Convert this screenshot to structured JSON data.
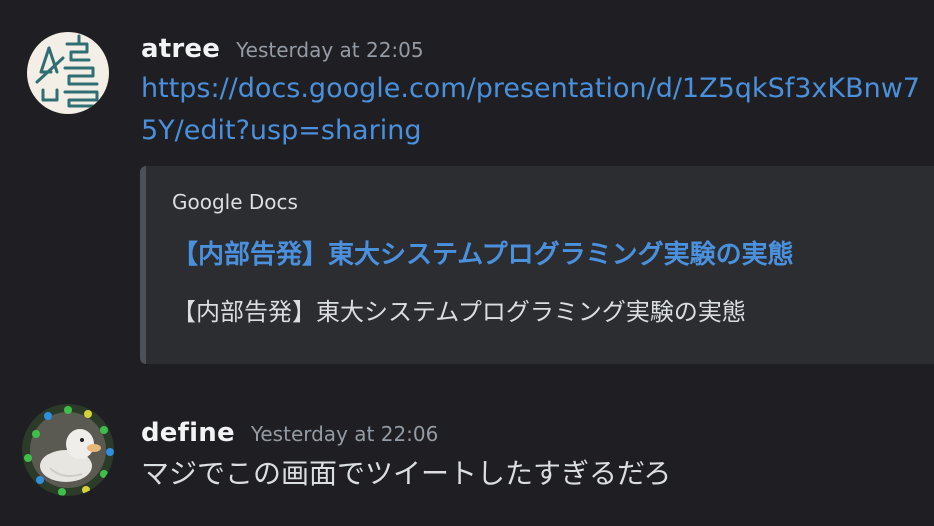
{
  "messages": [
    {
      "username": "atree",
      "timestamp": "Yesterday at 22:05",
      "link_line1": "https://docs.google.com/presentation/d/1Z5qkSf3xKBnw7",
      "link_line2": "5Y/edit?usp=sharing",
      "embed": {
        "provider": "Google Docs",
        "title": "【内部告発】東大システムプログラミング実験の実態",
        "description": "【内部告発】東大システムプログラミング実験の実態"
      }
    },
    {
      "username": "define",
      "timestamp": "Yesterday at 22:06",
      "content": "マジでこの画面でツイートしたすぎるだろ"
    }
  ],
  "colors": {
    "background": "#1f1f23",
    "embed_background": "#2b2d31",
    "embed_border": "#4e5058",
    "link": "#4a90dc",
    "username": "#f2f3f5",
    "timestamp": "#949ba4",
    "text": "#dbdee1"
  }
}
